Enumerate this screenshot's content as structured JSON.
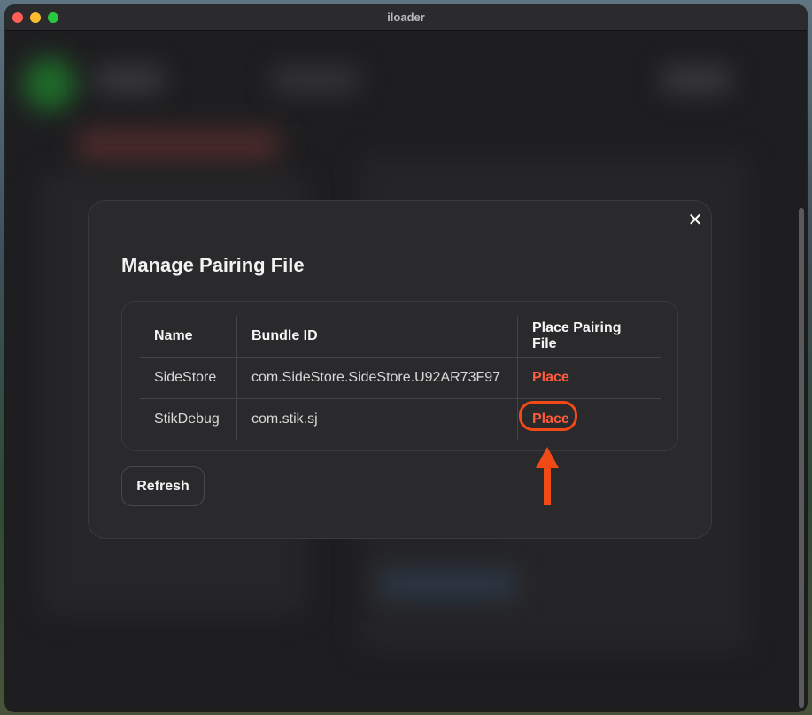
{
  "window": {
    "title": "iloader"
  },
  "modal": {
    "title": "Manage Pairing File",
    "close_glyph": "✕",
    "table": {
      "headers": [
        "Name",
        "Bundle ID",
        "Place Pairing File"
      ],
      "rows": [
        {
          "name": "SideStore",
          "bundle_id": "com.SideStore.SideStore.U92AR73F97",
          "action": "Place"
        },
        {
          "name": "StikDebug",
          "bundle_id": "com.stik.sj",
          "action": "Place"
        }
      ]
    },
    "refresh_label": "Refresh"
  },
  "colors": {
    "accent": "#ff5a3c",
    "annotation": "#f14a17",
    "modal_bg": "#2a2a2c"
  },
  "icons": [
    "close-icon",
    "annotation-arrow-icon"
  ]
}
